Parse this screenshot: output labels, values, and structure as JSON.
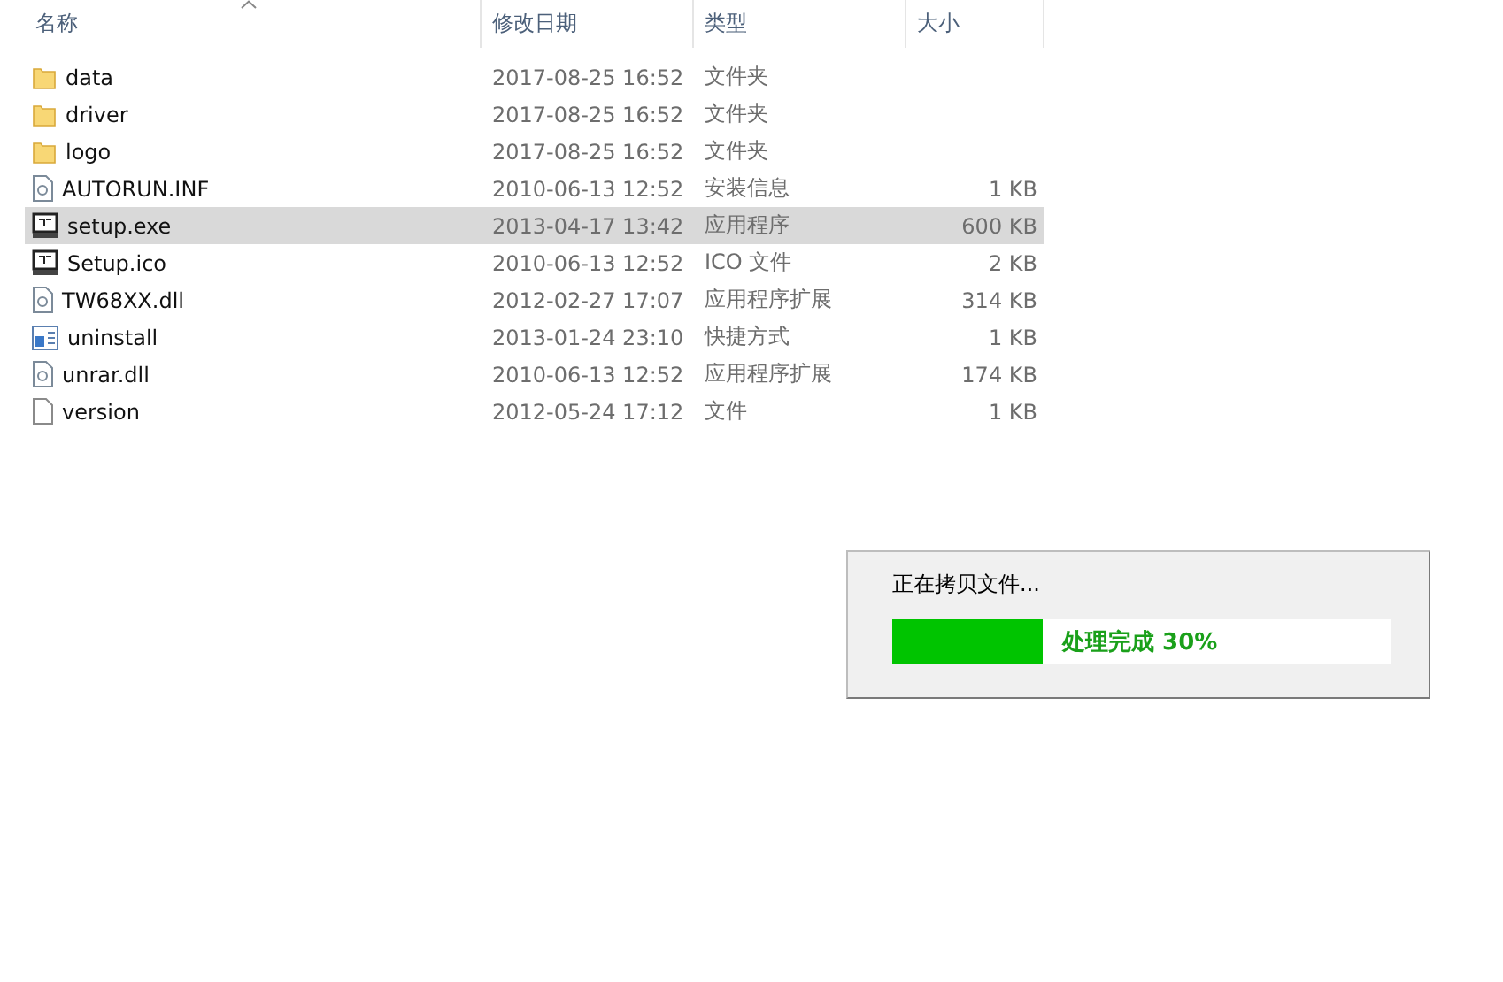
{
  "header": {
    "columns": [
      "名称",
      "修改日期",
      "类型",
      "大小"
    ]
  },
  "files": [
    {
      "name": "data",
      "date": "2017-08-25 16:52",
      "type": "文件夹",
      "kind": "folder",
      "selected": false
    },
    {
      "name": "driver",
      "date": "2017-08-25 16:52",
      "type": "文件夹",
      "kind": "folder",
      "selected": false
    },
    {
      "name": "logo",
      "date": "2017-08-25 16:52",
      "type": "文件夹",
      "kind": "folder",
      "selected": false
    },
    {
      "name": "AUTORUN.INF",
      "date": "2010-06-13 12:52",
      "type": "安装信息",
      "size": "1 KB",
      "kind": "settings",
      "selected": false
    },
    {
      "name": "setup.exe",
      "date": "2013-04-17 13:42",
      "type": "应用程序",
      "size": "600 KB",
      "kind": "program",
      "selected": true
    },
    {
      "name": "Setup.ico",
      "date": "2010-06-13 12:52",
      "type": "ICO 文件",
      "size": "2 KB",
      "kind": "program",
      "selected": false
    },
    {
      "name": "TW68XX.dll",
      "date": "2012-02-27 17:07",
      "type": "应用程序扩展",
      "size": "314 KB",
      "kind": "settings",
      "selected": false
    },
    {
      "name": "uninstall",
      "date": "2013-01-24 23:10",
      "type": "快捷方式",
      "size": "1 KB",
      "kind": "shortcut",
      "selected": false
    },
    {
      "name": "unrar.dll",
      "date": "2010-06-13 12:52",
      "type": "应用程序扩展",
      "size": "174 KB",
      "kind": "settings",
      "selected": false
    },
    {
      "name": "version",
      "date": "2012-05-24 17:12",
      "type": "文件",
      "size": "1 KB",
      "kind": "file",
      "selected": false
    }
  ],
  "progress_dialog": {
    "message": "正在拷贝文件...",
    "level": 0.3,
    "label": "处理完成 30%"
  }
}
